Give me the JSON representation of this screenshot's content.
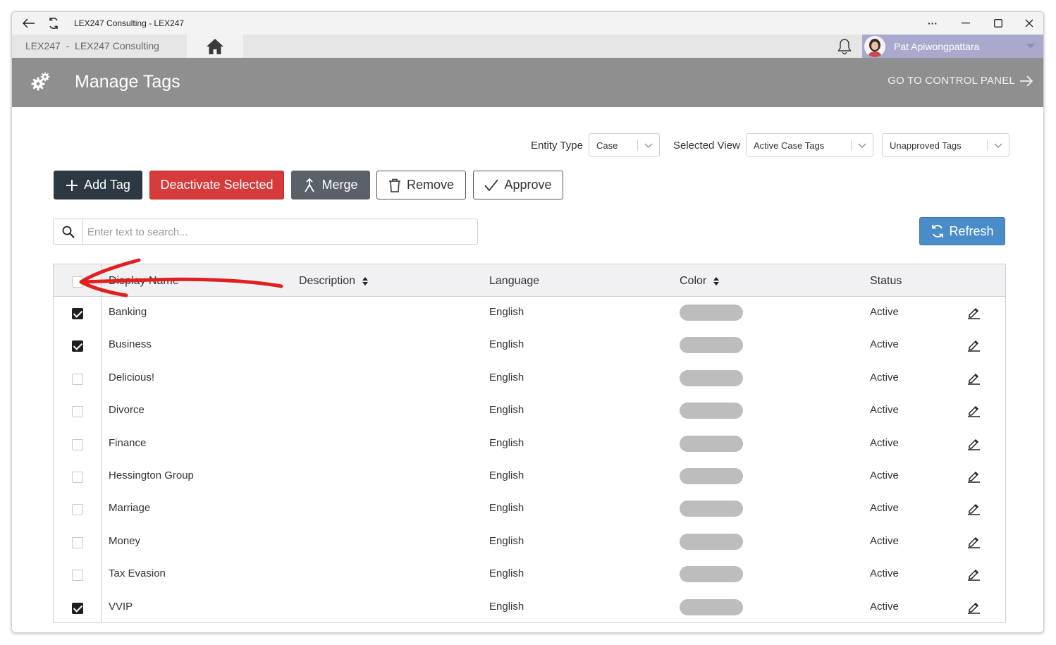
{
  "window": {
    "title": "LEX247 Consulting - LEX247",
    "more_label": "···",
    "minimize_label": "—",
    "close_label": "✕"
  },
  "appnav": {
    "breadcrumb": "LEX247  -  LEX247 Consulting",
    "user_name": "Pat Apiwongpattara"
  },
  "header": {
    "title": "Manage Tags",
    "control_panel_link": "GO TO CONTROL PANEL"
  },
  "filters": {
    "entity_type_label": "Entity Type",
    "entity_type_value": "Case",
    "selected_view_label": "Selected View",
    "selected_view_value": "Active Case Tags",
    "tag_filter_value": "Unapproved Tags"
  },
  "actions": {
    "add_tag": "Add Tag",
    "deactivate_selected": "Deactivate Selected",
    "merge": "Merge",
    "remove": "Remove",
    "approve": "Approve",
    "refresh": "Refresh"
  },
  "search": {
    "placeholder": "Enter text to search..."
  },
  "grid": {
    "columns": [
      "Display Name",
      "Description",
      "Language",
      "Color",
      "Status"
    ],
    "rows": [
      {
        "name": "Banking",
        "language": "English",
        "status": "Active",
        "checked": true
      },
      {
        "name": "Business",
        "language": "English",
        "status": "Active",
        "checked": true
      },
      {
        "name": "Delicious!",
        "language": "English",
        "status": "Active",
        "checked": false
      },
      {
        "name": "Divorce",
        "language": "English",
        "status": "Active",
        "checked": false
      },
      {
        "name": "Finance",
        "language": "English",
        "status": "Active",
        "checked": false
      },
      {
        "name": "Hessington Group",
        "language": "English",
        "status": "Active",
        "checked": false
      },
      {
        "name": "Marriage",
        "language": "English",
        "status": "Active",
        "checked": false
      },
      {
        "name": "Money",
        "language": "English",
        "status": "Active",
        "checked": false
      },
      {
        "name": "Tax Evasion",
        "language": "English",
        "status": "Active",
        "checked": false
      },
      {
        "name": "VVIP",
        "language": "English",
        "status": "Active",
        "checked": true
      }
    ]
  },
  "colors": {
    "header_bg": "#8f8f8f",
    "user_bg": "#a9a9ce",
    "add_button": "#2c3942",
    "deactivate_button": "#d63a3a",
    "merge_button": "#5a6169",
    "refresh_button": "#4a8cc8",
    "annotation_arrow": "#e02020",
    "tag_color_swatch": "#bdbdbd"
  },
  "icons": {
    "back": "arrow-left-icon",
    "reload": "refresh-icon",
    "home": "home-icon",
    "notifications": "bell-icon",
    "settings": "gears-icon",
    "search": "search-icon",
    "edit": "pencil-icon"
  }
}
